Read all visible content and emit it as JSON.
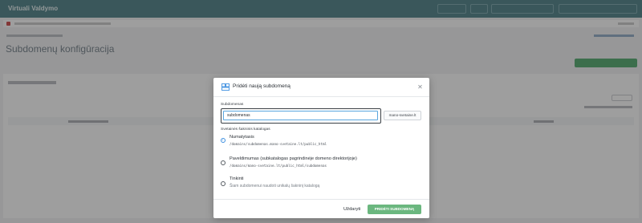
{
  "background": {
    "brand": "Virtuali Valdymo",
    "page_title": "Subdomenų konfigūracija"
  },
  "modal": {
    "title": "Pridėti naują subdomeną",
    "close_icon": "close-icon",
    "header_icon": "subdomain-icon",
    "subdomain_label": "Subdomenas",
    "subdomain_value": "subdomenas",
    "domain_button": "mano-svetaine.lt",
    "root_heading": "Svetainės šakninis katalogas",
    "options": [
      {
        "title": "Numatytasis",
        "path": "/domains/subdomenas.mano-svetaine.lt/public_html",
        "checked": true
      },
      {
        "title": "Paveldimumas (subkatalogas pagrindinėje domeno direktorijoje)",
        "path": "/domains/mano-svetaine.lt/public_html/subdomenas",
        "checked": false
      },
      {
        "title": "Tinkinti",
        "description": "Šiam subdomenui naudoti unikalų šakninį katalogą",
        "checked": false
      }
    ],
    "cancel_label": "Uždaryti",
    "submit_label": "PRIDĖTI SUBDOMENĄ"
  },
  "colors": {
    "accent": "#3d8fe0",
    "submit": "#6bb77f",
    "topbar": "#4a7e86"
  }
}
